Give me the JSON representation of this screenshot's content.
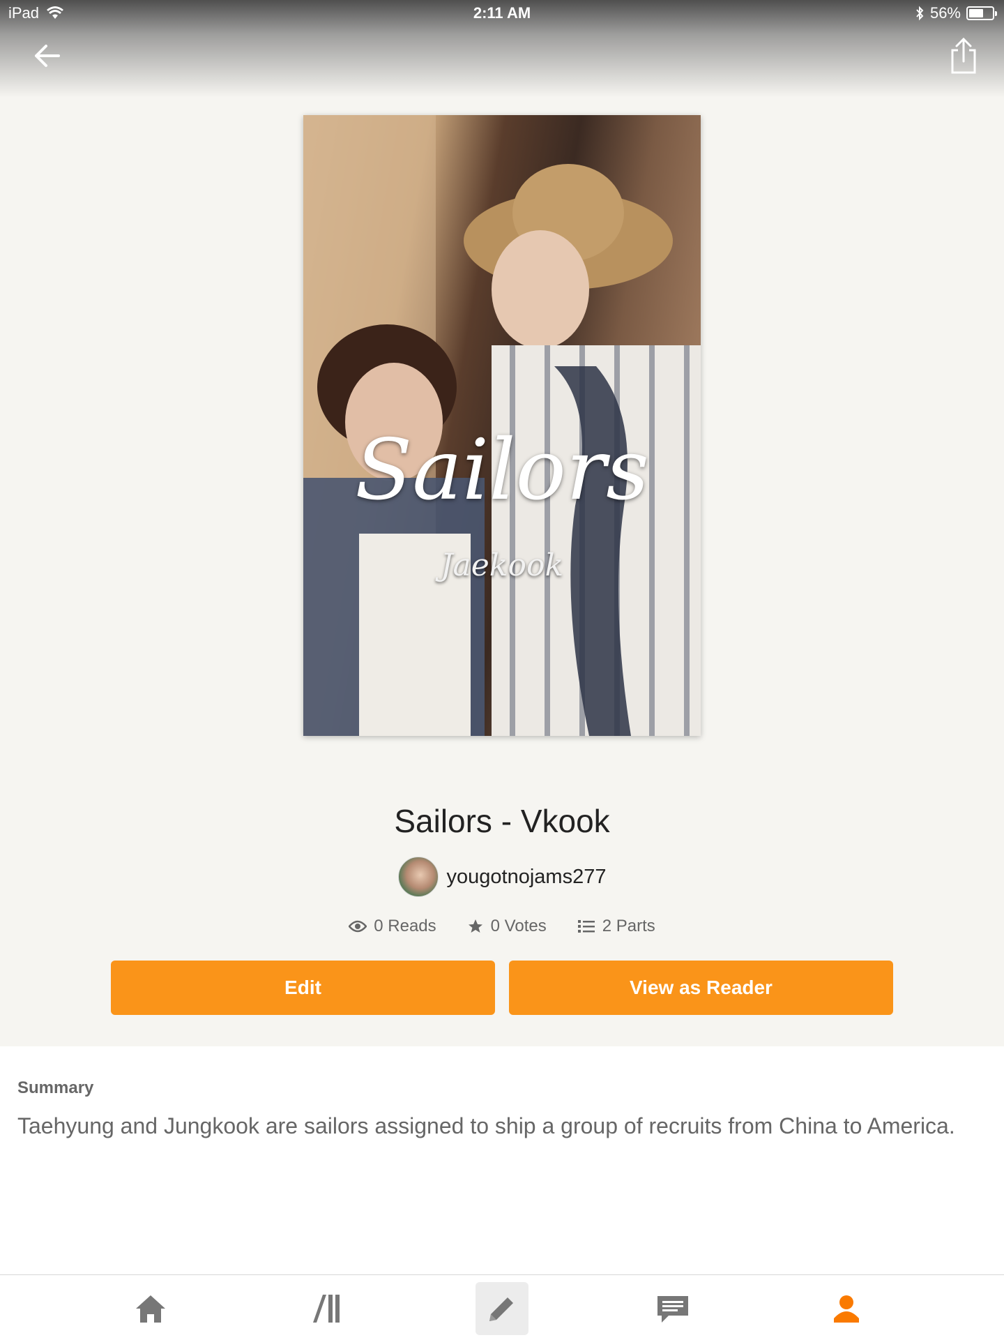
{
  "status_bar": {
    "device": "iPad",
    "time": "2:11 AM",
    "battery": "56%"
  },
  "story": {
    "cover_title": "Sailors",
    "cover_subtitle": "Jaekook",
    "title": "Sailors - Vkook",
    "author": "yougotnojams277",
    "stats": {
      "reads": "0 Reads",
      "votes": "0 Votes",
      "parts": "2 Parts"
    }
  },
  "buttons": {
    "edit": "Edit",
    "view_as_reader": "View as Reader"
  },
  "summary": {
    "label": "Summary",
    "text": "Taehyung and Jungkook are sailors assigned to ship a group of recruits from China to America."
  },
  "tab_bar": {
    "items": [
      "home-icon",
      "library-icon",
      "write-icon",
      "messages-icon",
      "profile-icon"
    ],
    "active": "write-icon"
  },
  "colors": {
    "accent": "#fa9419",
    "active_tab": "#fa7a00",
    "background": "#f6f5f1"
  }
}
